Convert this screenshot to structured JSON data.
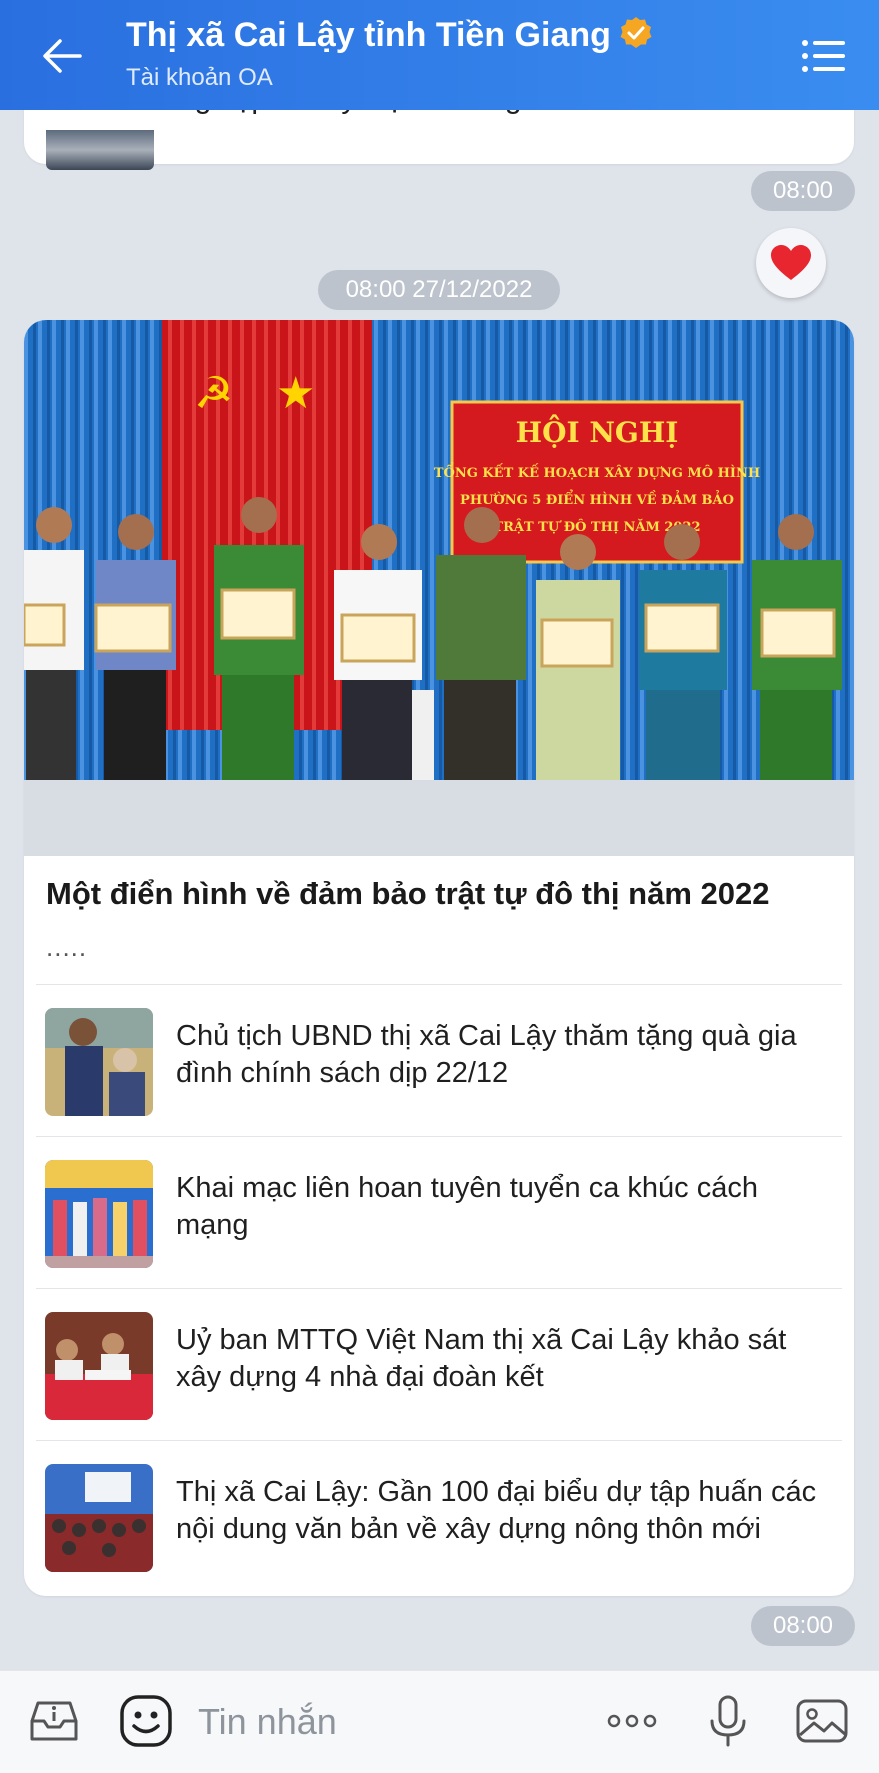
{
  "header": {
    "title": "Thị xã Cai Lậy tỉnh Tiền Giang",
    "subtitle": "Tài khoản OA"
  },
  "previous_message": {
    "partial_text": "nghiệp xã Mỹ Hạnh Trung"
  },
  "time_stamp_1": "08:00",
  "date_separator": "08:00 27/12/2022",
  "reaction": {
    "icon": "heart-icon",
    "color": "#e8262f"
  },
  "article_card": {
    "banner": {
      "heading": "HỘI NGHỊ",
      "line1": "TỔNG KẾT KẾ HOẠCH XÂY DỰNG MÔ HÌNH",
      "line2": "PHƯỜNG 5 ĐIỂN HÌNH VỀ ĐẢM BẢO",
      "line3": "TRẬT TỰ ĐÔ THỊ NĂM 2022"
    },
    "title": "Một điển hình về đảm bảo trật tự đô thị năm 2022",
    "snippet": "....."
  },
  "news_list": [
    {
      "title": "Chủ tịch UBND thị xã Cai Lậy thăm tặng quà gia đình chính sách dịp 22/12"
    },
    {
      "title": "Khai mạc liên hoan tuyên tuyển ca khúc cách mạng"
    },
    {
      "title": "Uỷ ban MTTQ Việt Nam thị xã Cai Lậy khảo sát xây dựng 4 nhà đại đoàn kết"
    },
    {
      "title": "Thị xã Cai Lậy: Gần 100 đại biểu dự tập huấn các nội dung văn bản về xây dựng nông thôn mới"
    }
  ],
  "time_stamp_2": "08:00",
  "composer": {
    "placeholder": "Tin nhắn"
  },
  "colors": {
    "header_start": "#2a6fe0",
    "header_end": "#3a8df0",
    "verified": "#f5a623",
    "background": "#dfe3ea"
  }
}
